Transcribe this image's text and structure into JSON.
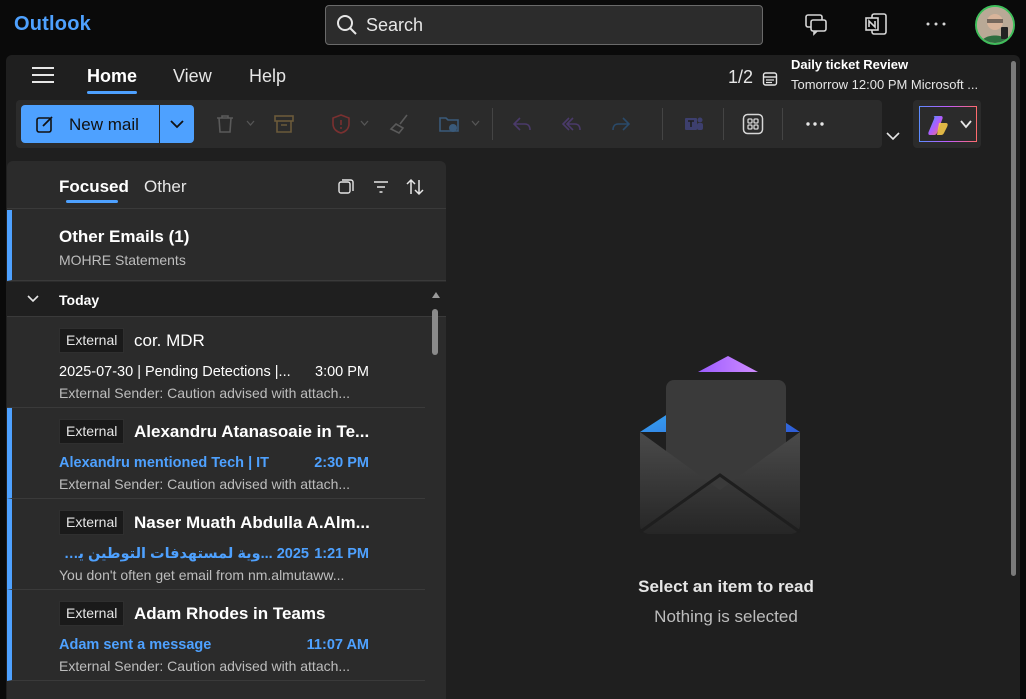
{
  "app": {
    "brand": "Outlook"
  },
  "search": {
    "placeholder": "Search"
  },
  "nav": {
    "tabs": [
      {
        "label": "Home",
        "active": true
      },
      {
        "label": "View",
        "active": false
      },
      {
        "label": "Help",
        "active": false
      }
    ],
    "pager": "1/2",
    "reminder": {
      "title": "Daily ticket Review",
      "detail": "Tomorrow 12:00 PM Microsoft ..."
    }
  },
  "ribbon": {
    "new_mail_label": "New mail"
  },
  "list": {
    "pivots": [
      {
        "label": "Focused",
        "active": true
      },
      {
        "label": "Other",
        "active": false
      }
    ],
    "other_emails": {
      "title": "Other Emails (1)",
      "subtitle": "MOHRE Statements"
    },
    "group_label": "Today",
    "messages": [
      {
        "badge": "External",
        "sender": "cor. MDR",
        "subject": "2025-07-30 | Pending Detections |...",
        "time": "3:00 PM",
        "preview": "External Sender: Caution advised with attach...",
        "unread": false
      },
      {
        "badge": "External",
        "sender": "Alexandru Atanasoaie in Te...",
        "subject": "Alexandru mentioned Tech | IT",
        "time": "2:30 PM",
        "preview": "External Sender: Caution advised with attach...",
        "unread": true
      },
      {
        "badge": "External",
        "sender": "Naser Muath Abdulla A.Alm...",
        "subject": "2025 ...وية لمستهدفات التوطين يوليو",
        "time": "1:21 PM",
        "preview": "You don't often get email from nm.almutaww...",
        "unread": true
      },
      {
        "badge": "External",
        "sender": "Adam Rhodes in Teams",
        "subject": "Adam sent a message",
        "time": "11:07 AM",
        "preview": "External Sender: Caution advised with attach...",
        "unread": true
      }
    ]
  },
  "reading_pane": {
    "title": "Select an item to read",
    "subtitle": "Nothing is selected"
  },
  "colors": {
    "accent": "#4ea1ff",
    "background": "#0a0a0a",
    "surface": "#1f1f1f",
    "list_bg": "#2b2b2b"
  }
}
